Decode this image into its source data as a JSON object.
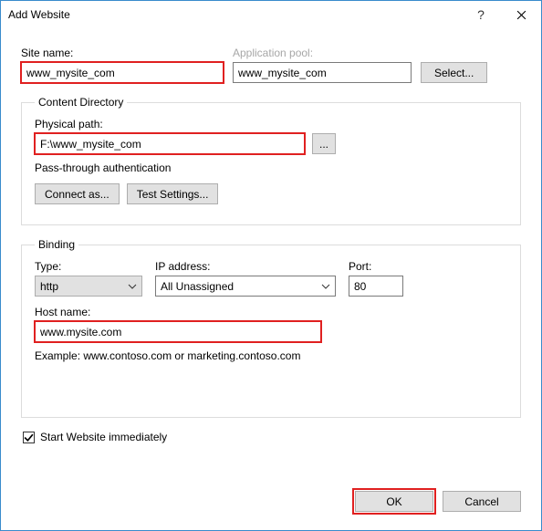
{
  "window": {
    "title": "Add Website"
  },
  "siteName": {
    "label": "Site name:",
    "value": "www_mysite_com"
  },
  "appPool": {
    "label": "Application pool:",
    "value": "www_mysite_com",
    "selectButton": "Select..."
  },
  "contentDirectory": {
    "legend": "Content Directory",
    "physicalPathLabel": "Physical path:",
    "physicalPathValue": "F:\\www_mysite_com",
    "browseButton": "...",
    "authText": "Pass-through authentication",
    "connectAs": "Connect as...",
    "testSettings": "Test Settings..."
  },
  "binding": {
    "legend": "Binding",
    "typeLabel": "Type:",
    "typeValue": "http",
    "ipLabel": "IP address:",
    "ipValue": "All Unassigned",
    "portLabel": "Port:",
    "portValue": "80",
    "hostLabel": "Host name:",
    "hostValue": "www.mysite.com",
    "example": "Example: www.contoso.com or marketing.contoso.com"
  },
  "startImmediately": {
    "label": "Start Website immediately",
    "checked": true
  },
  "footer": {
    "ok": "OK",
    "cancel": "Cancel"
  }
}
